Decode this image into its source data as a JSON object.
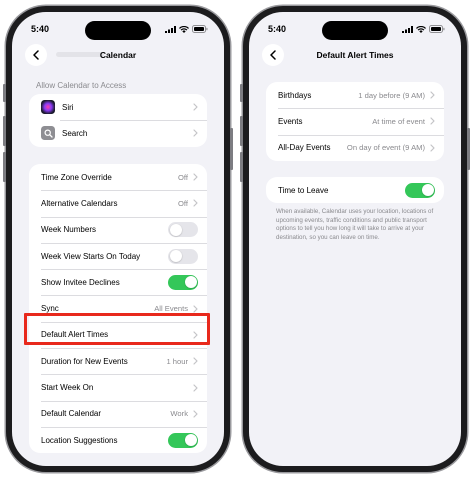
{
  "status": {
    "time": "5:40"
  },
  "left": {
    "nav_title": "Calendar",
    "section_header": "Allow Calendar to Access",
    "access_items": [
      {
        "label": "Siri",
        "icon": "siri-icon"
      },
      {
        "label": "Search",
        "icon": "search-icon"
      }
    ],
    "settings": [
      {
        "label": "Time Zone Override",
        "value": "Off",
        "control": "chevron"
      },
      {
        "label": "Alternative Calendars",
        "value": "Off",
        "control": "chevron"
      },
      {
        "label": "Week Numbers",
        "control": "toggle",
        "on": false
      },
      {
        "label": "Week View Starts On Today",
        "control": "toggle",
        "on": false
      },
      {
        "label": "Show Invitee Declines",
        "control": "toggle",
        "on": true
      },
      {
        "label": "Sync",
        "value": "All Events",
        "control": "chevron"
      },
      {
        "label": "Default Alert Times",
        "value": "",
        "control": "chevron",
        "highlighted": true
      },
      {
        "label": "Duration for New Events",
        "value": "1 hour",
        "control": "chevron"
      },
      {
        "label": "Start Week On",
        "value": "",
        "control": "chevron"
      },
      {
        "label": "Default Calendar",
        "value": "Work",
        "control": "chevron"
      },
      {
        "label": "Location Suggestions",
        "control": "toggle",
        "on": true
      }
    ]
  },
  "right": {
    "nav_title": "Default Alert Times",
    "alerts": [
      {
        "label": "Birthdays",
        "value": "1 day before (9 AM)"
      },
      {
        "label": "Events",
        "value": "At time of event"
      },
      {
        "label": "All-Day Events",
        "value": "On day of event (9 AM)"
      }
    ],
    "time_to_leave": {
      "label": "Time to Leave",
      "on": true
    },
    "footer": "When available, Calendar uses your location, locations of upcoming events, traffic conditions and public transport options to tell you how long it will take to arrive at your destination, so you can leave on time."
  },
  "colors": {
    "toggle_on": "#34c759",
    "highlight": "#e8291c",
    "background": "#f2f2f7"
  }
}
